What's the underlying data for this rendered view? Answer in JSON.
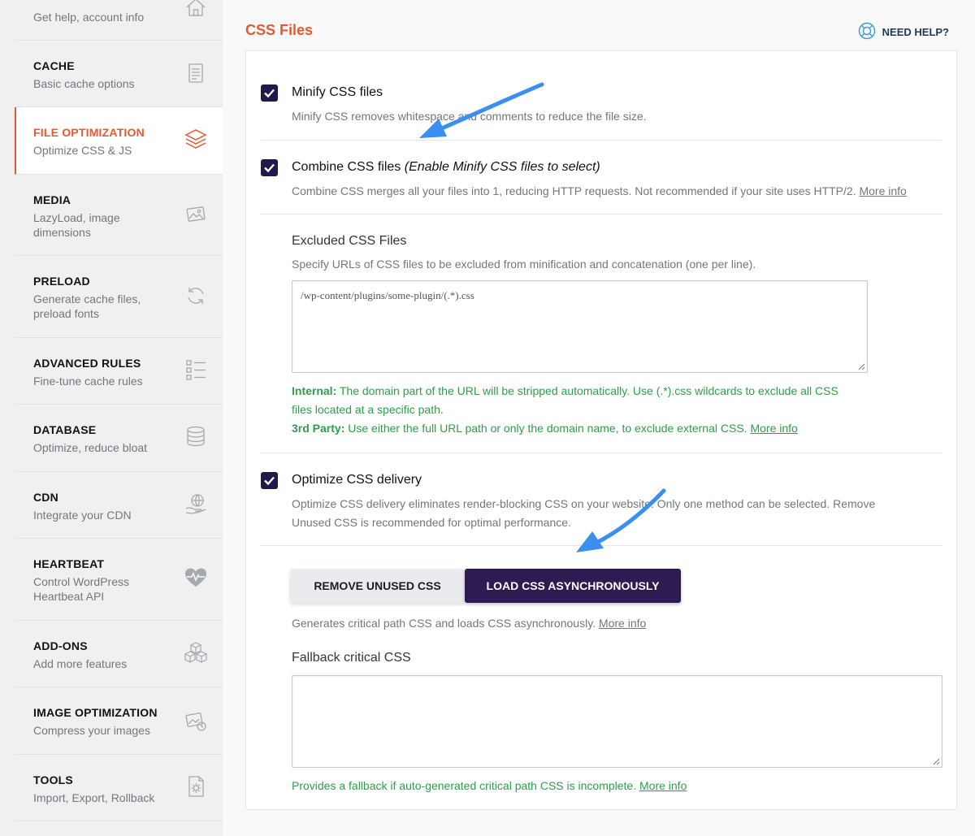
{
  "sidebar": {
    "items": [
      {
        "title": "",
        "desc": "Get help, account info",
        "icon": "home-icon"
      },
      {
        "title": "CACHE",
        "desc": "Basic cache options",
        "icon": "file-icon"
      },
      {
        "title": "FILE OPTIMIZATION",
        "desc": "Optimize CSS & JS",
        "icon": "layers-icon"
      },
      {
        "title": "MEDIA",
        "desc": "LazyLoad, image dimensions",
        "icon": "image-icon"
      },
      {
        "title": "PRELOAD",
        "desc": "Generate cache files, preload fonts",
        "icon": "refresh-icon"
      },
      {
        "title": "ADVANCED RULES",
        "desc": "Fine-tune cache rules",
        "icon": "list-icon"
      },
      {
        "title": "DATABASE",
        "desc": "Optimize, reduce bloat",
        "icon": "database-icon"
      },
      {
        "title": "CDN",
        "desc": "Integrate your CDN",
        "icon": "cdn-icon"
      },
      {
        "title": "HEARTBEAT",
        "desc": "Control WordPress Heartbeat API",
        "icon": "heartbeat-icon"
      },
      {
        "title": "ADD-ONS",
        "desc": "Add more features",
        "icon": "cubes-icon"
      },
      {
        "title": "IMAGE OPTIMIZATION",
        "desc": "Compress your images",
        "icon": "image-optimization-icon"
      },
      {
        "title": "TOOLS",
        "desc": "Import, Export, Rollback",
        "icon": "tools-icon"
      }
    ],
    "active_index": 2
  },
  "header": {
    "title": "CSS Files",
    "help_label": "NEED HELP?"
  },
  "minify": {
    "checked": true,
    "label": "Minify CSS files",
    "desc": "Minify CSS removes whitespace and comments to reduce the file size."
  },
  "combine": {
    "checked": true,
    "label": "Combine CSS files",
    "label_note": "(Enable Minify CSS files to select)",
    "desc": "Combine CSS merges all your files into 1, reducing HTTP requests. Not recommended if your site uses HTTP/2.",
    "more_info": "More info"
  },
  "excluded": {
    "title": "Excluded CSS Files",
    "desc": "Specify URLs of CSS files to be excluded from minification and concatenation (one per line).",
    "value": "/wp-content/plugins/some-plugin/(.*).css",
    "internal_label": "Internal:",
    "internal_text_1": "The domain part of the URL will be stripped automatically. Use (.*).css wildcards to exclude all CSS",
    "internal_text_2": "files located at a specific path.",
    "third_party_label": "3rd Party:",
    "third_party_text": "Use either the full URL path or only the domain name, to exclude external CSS.",
    "more_info": "More info"
  },
  "delivery": {
    "checked": true,
    "label": "Optimize CSS delivery",
    "desc_1": "Optimize CSS delivery eliminates render-blocking CSS on your website. Only one method can be selected. Remove",
    "desc_2": "Unused CSS is recommended for optimal performance.",
    "btn_remove": "REMOVE UNUSED CSS",
    "btn_async": "LOAD CSS ASYNCHRONOUSLY",
    "selected": "LOAD CSS ASYNCHRONOUSLY",
    "async_desc": "Generates critical path CSS and loads CSS asynchronously.",
    "more_info": "More info"
  },
  "fallback": {
    "title": "Fallback critical CSS",
    "value": "",
    "hint": "Provides a fallback if auto-generated critical path CSS is incomplete.",
    "more_info": "More info"
  },
  "colors": {
    "accent": "#e9582f",
    "dark_button": "#2d1b52",
    "checkbox": "#1e1a4a",
    "green_hint": "#2e9e4a",
    "annotation_arrow": "#3b8ff0"
  }
}
